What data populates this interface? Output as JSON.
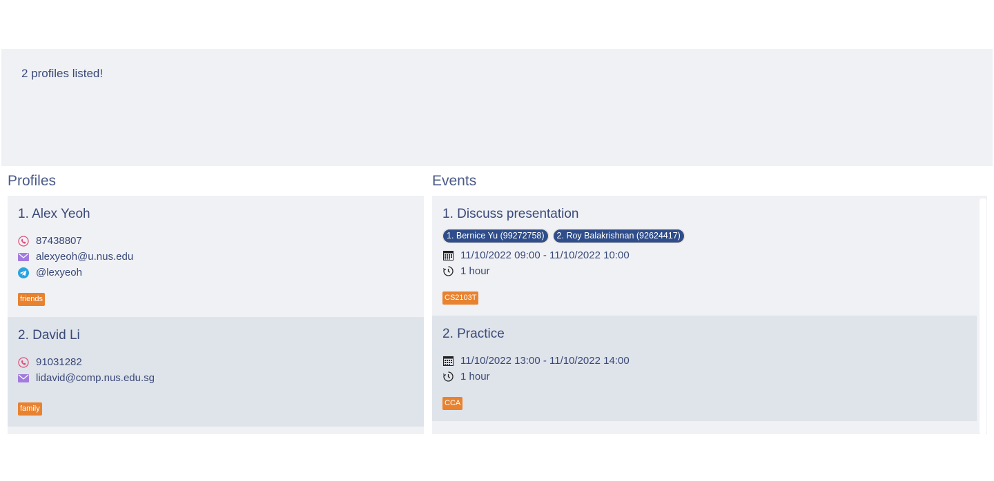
{
  "result": {
    "text": "2 profiles listed!"
  },
  "profiles": {
    "title": "Profiles",
    "items": [
      {
        "title": "1.  Alex Yeoh",
        "phone": "87438807",
        "email": "alexyeoh@u.nus.edu",
        "telegram": "@lexyeoh",
        "tag": "friends"
      },
      {
        "title": "2.  David Li",
        "phone": "91031282",
        "email": "lidavid@comp.nus.edu.sg",
        "tag": "family"
      }
    ]
  },
  "events": {
    "title": "Events",
    "items": [
      {
        "title": "1.  Discuss presentation",
        "attendees": [
          "1. Bernice Yu (99272758)",
          "2. Roy Balakrishnan (92624417)"
        ],
        "datetime": "11/10/2022 09:00 - 11/10/2022 10:00",
        "duration": "1 hour",
        "tag": "CS2103T"
      },
      {
        "title": "2.  Practice",
        "datetime": "11/10/2022 13:00 - 11/10/2022 14:00",
        "duration": "1 hour",
        "tag": "CCA"
      }
    ]
  },
  "colors": {
    "accent_tag": "#e8822f",
    "chip": "#2f4d8a",
    "panel": "#f0f1f5",
    "alt_row": "#dfe3ea",
    "text": "#3a4a78"
  }
}
